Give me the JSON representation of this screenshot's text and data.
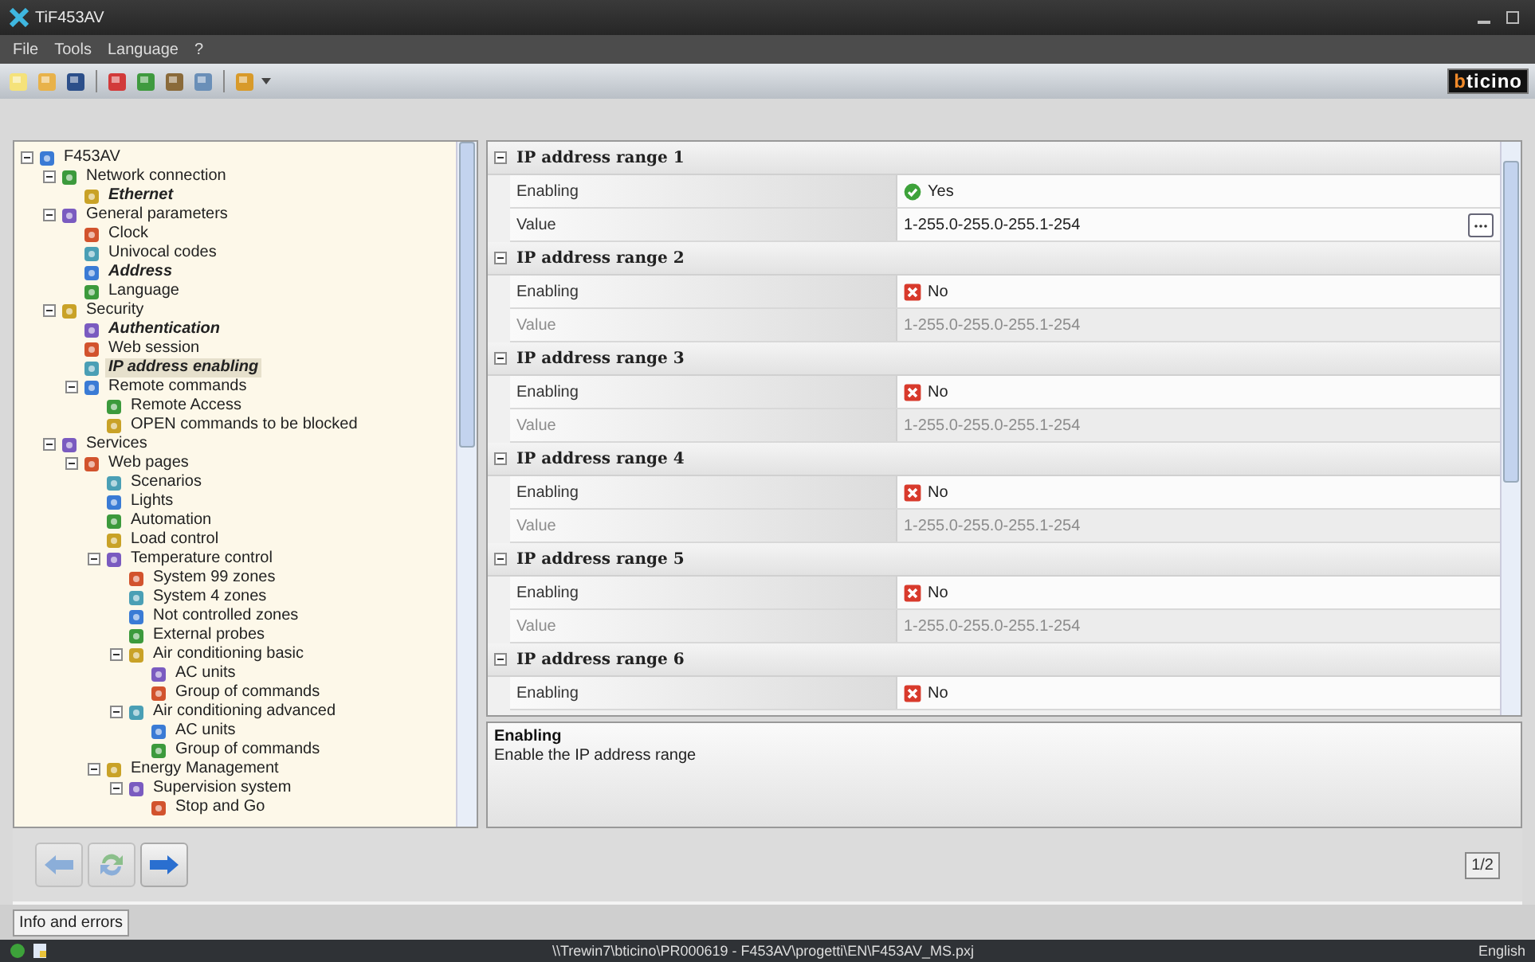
{
  "window": {
    "title": "TiF453AV"
  },
  "menu": [
    "File",
    "Tools",
    "Language",
    "?"
  ],
  "logo": "bticino",
  "tree": {
    "items": [
      {
        "label": "F453AV",
        "selected": false,
        "emphasized": false,
        "expanded": true,
        "children": [
          {
            "label": "Network connection",
            "selected": false,
            "emphasized": false,
            "expanded": true,
            "children": [
              {
                "label": "Ethernet",
                "selected": false,
                "emphasized": true
              }
            ]
          },
          {
            "label": "General parameters",
            "selected": false,
            "emphasized": false,
            "expanded": true,
            "children": [
              {
                "label": "Clock",
                "selected": false,
                "emphasized": false
              },
              {
                "label": "Univocal codes",
                "selected": false,
                "emphasized": false
              },
              {
                "label": "Address",
                "selected": false,
                "emphasized": true
              },
              {
                "label": "Language",
                "selected": false,
                "emphasized": false
              }
            ]
          },
          {
            "label": "Security",
            "selected": false,
            "emphasized": false,
            "expanded": true,
            "children": [
              {
                "label": "Authentication",
                "selected": false,
                "emphasized": true
              },
              {
                "label": "Web session",
                "selected": false,
                "emphasized": false
              },
              {
                "label": "IP address enabling",
                "selected": true,
                "emphasized": true
              },
              {
                "label": "Remote commands",
                "selected": false,
                "emphasized": false,
                "expanded": true,
                "children": [
                  {
                    "label": "Remote Access",
                    "selected": false,
                    "emphasized": false
                  },
                  {
                    "label": "OPEN commands to be blocked",
                    "selected": false,
                    "emphasized": false
                  }
                ]
              }
            ]
          },
          {
            "label": "Services",
            "selected": false,
            "emphasized": false,
            "expanded": true,
            "children": [
              {
                "label": "Web pages",
                "selected": false,
                "emphasized": false,
                "expanded": true,
                "children": [
                  {
                    "label": "Scenarios",
                    "selected": false,
                    "emphasized": false
                  },
                  {
                    "label": "Lights",
                    "selected": false,
                    "emphasized": false
                  },
                  {
                    "label": "Automation",
                    "selected": false,
                    "emphasized": false
                  },
                  {
                    "label": "Load control",
                    "selected": false,
                    "emphasized": false
                  },
                  {
                    "label": "Temperature control",
                    "selected": false,
                    "emphasized": false,
                    "expanded": true,
                    "children": [
                      {
                        "label": "System 99 zones",
                        "selected": false,
                        "emphasized": false
                      },
                      {
                        "label": "System 4 zones",
                        "selected": false,
                        "emphasized": false
                      },
                      {
                        "label": "Not controlled zones",
                        "selected": false,
                        "emphasized": false
                      },
                      {
                        "label": "External probes",
                        "selected": false,
                        "emphasized": false
                      },
                      {
                        "label": "Air conditioning basic",
                        "selected": false,
                        "emphasized": false,
                        "expanded": true,
                        "children": [
                          {
                            "label": "AC units",
                            "selected": false,
                            "emphasized": false
                          },
                          {
                            "label": "Group of commands",
                            "selected": false,
                            "emphasized": false
                          }
                        ]
                      },
                      {
                        "label": "Air conditioning advanced",
                        "selected": false,
                        "emphasized": false,
                        "expanded": true,
                        "children": [
                          {
                            "label": "AC units",
                            "selected": false,
                            "emphasized": false
                          },
                          {
                            "label": "Group of commands",
                            "selected": false,
                            "emphasized": false
                          }
                        ]
                      }
                    ]
                  },
                  {
                    "label": "Energy Management",
                    "selected": false,
                    "emphasized": false,
                    "expanded": true,
                    "children": [
                      {
                        "label": "Supervision system",
                        "selected": false,
                        "emphasized": false,
                        "expanded": true,
                        "children": [
                          {
                            "label": "Stop and Go",
                            "selected": false,
                            "emphasized": false
                          }
                        ]
                      }
                    ]
                  }
                ]
              }
            ]
          }
        ]
      }
    ]
  },
  "properties": {
    "groups": [
      {
        "title": "IP address range 1",
        "expanded": true,
        "rows": [
          {
            "kind": "toggle",
            "label": "Enabling",
            "value": "Yes",
            "checked": true
          },
          {
            "kind": "text",
            "label": "Value",
            "value": "1-255.0-255.0-255.1-254",
            "disabled": false
          }
        ]
      },
      {
        "title": "IP address range 2",
        "expanded": true,
        "rows": [
          {
            "kind": "toggle",
            "label": "Enabling",
            "value": "No",
            "checked": false
          },
          {
            "kind": "text",
            "label": "Value",
            "value": "1-255.0-255.0-255.1-254",
            "disabled": true
          }
        ]
      },
      {
        "title": "IP address range 3",
        "expanded": true,
        "rows": [
          {
            "kind": "toggle",
            "label": "Enabling",
            "value": "No",
            "checked": false
          },
          {
            "kind": "text",
            "label": "Value",
            "value": "1-255.0-255.0-255.1-254",
            "disabled": true
          }
        ]
      },
      {
        "title": "IP address range 4",
        "expanded": true,
        "rows": [
          {
            "kind": "toggle",
            "label": "Enabling",
            "value": "No",
            "checked": false
          },
          {
            "kind": "text",
            "label": "Value",
            "value": "1-255.0-255.0-255.1-254",
            "disabled": true
          }
        ]
      },
      {
        "title": "IP address range 5",
        "expanded": true,
        "rows": [
          {
            "kind": "toggle",
            "label": "Enabling",
            "value": "No",
            "checked": false
          },
          {
            "kind": "text",
            "label": "Value",
            "value": "1-255.0-255.0-255.1-254",
            "disabled": true
          }
        ]
      },
      {
        "title": "IP address range 6",
        "expanded": true,
        "rows": [
          {
            "kind": "toggle",
            "label": "Enabling",
            "value": "No",
            "checked": false
          }
        ]
      }
    ]
  },
  "description": {
    "title": "Enabling",
    "text": "Enable the IP address range"
  },
  "navigation": {
    "buttons": [
      {
        "kind": "back",
        "disabled": true
      },
      {
        "kind": "refresh",
        "disabled": true
      },
      {
        "kind": "forward",
        "disabled": false
      }
    ],
    "page": "1/2"
  },
  "info_tab": "Info and errors",
  "status_bar": {
    "path": "\\\\Trewin7\\bticino\\PR000619 - F453AV\\progetti\\EN\\F453AV_MS.pxj",
    "language": "English"
  }
}
